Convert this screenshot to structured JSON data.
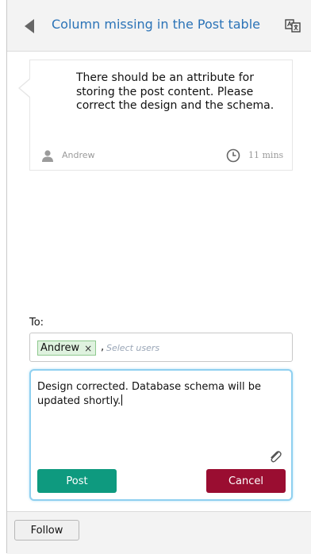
{
  "header": {
    "back_icon": "arrow-left-icon",
    "title": "Column missing in the Post table",
    "translate_icon": "translate-icon"
  },
  "comment": {
    "text": "There should be an attribute for storing the post content. Please correct the design and the schema.",
    "author": "Andrew",
    "author_icon": "user-icon",
    "time": "11 mins",
    "time_icon": "clock-icon"
  },
  "reply": {
    "to_label": "To:",
    "recipients": [
      {
        "name": "Andrew",
        "remove": "×"
      }
    ],
    "separator": ",",
    "select_users_placeholder": "Select users",
    "text": "Design corrected. Database schema will be updated shortly.",
    "attach_icon": "paperclip-icon",
    "post_label": "Post",
    "cancel_label": "Cancel"
  },
  "footer": {
    "follow_label": "Follow"
  },
  "colors": {
    "title_link": "#2b73b7",
    "post_button": "#0e9a7f",
    "cancel_button": "#9a0d31",
    "compose_border": "#8fd0f0",
    "chip_background": "#dff2df"
  }
}
